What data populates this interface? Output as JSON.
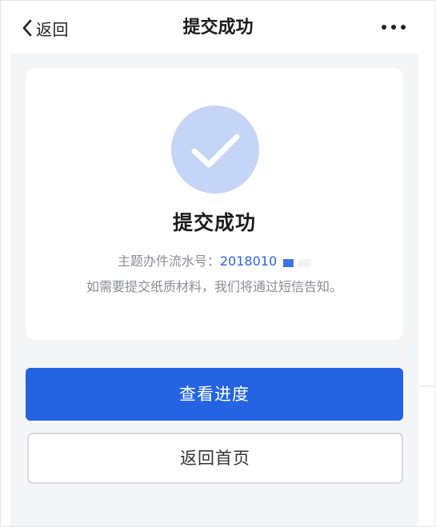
{
  "nav": {
    "back_label": "返回",
    "title": "提交成功"
  },
  "result": {
    "title": "提交成功",
    "serial_label": "主题办件流水号：",
    "serial_value": "2018010",
    "note": "如需要提交纸质材料，我们将通过短信告知。"
  },
  "actions": {
    "primary_label": "查看进度",
    "secondary_label": "返回首页"
  },
  "colors": {
    "accent": "#2464e2",
    "success_circle": "#c5d5f6",
    "link": "#2b63e0"
  },
  "icons": {
    "back": "chevron-left-icon",
    "more": "more-horizontal-icon",
    "success": "checkmark-icon"
  }
}
